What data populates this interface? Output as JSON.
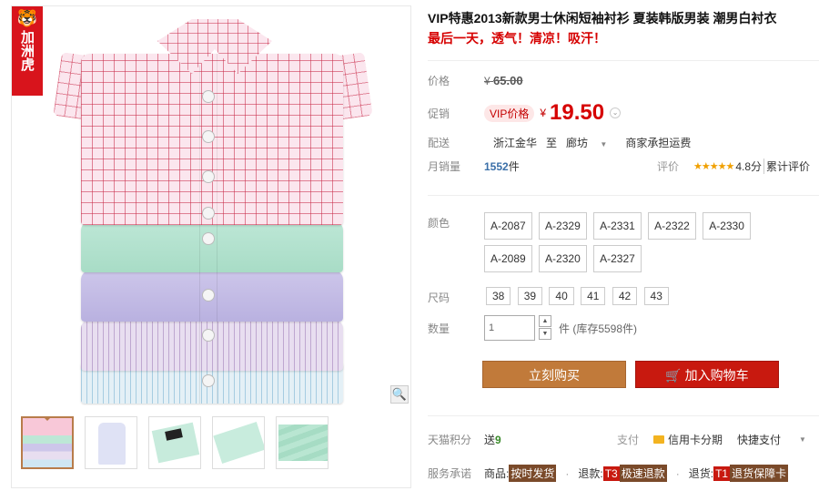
{
  "brand": {
    "text": "加洲虎",
    "icon": "tiger-logo-icon"
  },
  "product": {
    "title": "VIP特惠2013新款男士休闲短袖衬衫 夏装韩版男装 潮男白衬衣",
    "subtitle": "最后一天，透气！清凉！吸汗！"
  },
  "labels": {
    "price": "价格",
    "promo": "促销",
    "shipping": "配送",
    "monthly_sales": "月销量",
    "rating": "评价",
    "color": "颜色",
    "size": "尺码",
    "quantity": "数量",
    "points": "天猫积分",
    "service": "服务承诺"
  },
  "price": {
    "currency": "¥",
    "original": "65.00",
    "vip_badge": "VIP价格",
    "current": "19.50"
  },
  "shipping": {
    "from": "浙江金华",
    "to_word": "至",
    "to": "廊坊",
    "note": "商家承担运费"
  },
  "sales": {
    "count": "1552",
    "unit": "件"
  },
  "rating": {
    "stars": "★★★★★",
    "score": "4.8分",
    "link": "累计评价"
  },
  "colors": [
    "A-2087",
    "A-2329",
    "A-2331",
    "A-2322",
    "A-2330",
    "A-2089",
    "A-2320",
    "A-2327"
  ],
  "sizes": [
    "38",
    "39",
    "40",
    "41",
    "42",
    "43"
  ],
  "quantity": {
    "value": "1",
    "stock": "件 (库存5598件)"
  },
  "buttons": {
    "buy": "立刻购买",
    "cart": "加入购物车"
  },
  "points": {
    "label": "送",
    "value": "9"
  },
  "payment": {
    "label": "支付",
    "installment": "信用卡分期",
    "quick": "快捷支付"
  },
  "service": {
    "goods": "商品:",
    "goods_tag": "按时发货",
    "refund": "退款:",
    "refund_code": "T3",
    "refund_tag": "极速退款",
    "return": "退货:",
    "return_code": "T1",
    "return_tag": "退货保障卡"
  }
}
